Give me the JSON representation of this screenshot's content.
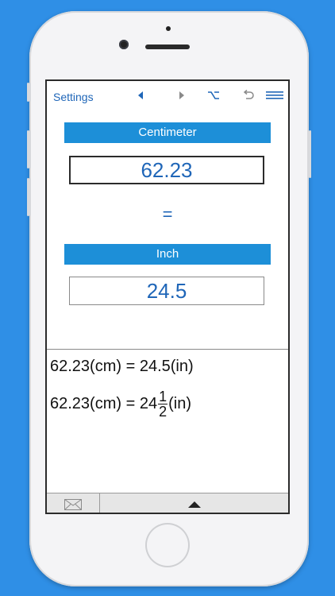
{
  "toolbar": {
    "settings_label": "Settings",
    "icons": [
      "back-arrow-icon",
      "forward-arrow-icon",
      "option-key-icon",
      "undo-icon",
      "menu-icon"
    ]
  },
  "converter": {
    "from_unit": "Centimeter",
    "from_value": "62.23",
    "equals": "=",
    "to_unit": "Inch",
    "to_value": "24.5"
  },
  "results": {
    "line1": "62.23(cm) = 24.5(in)",
    "line2_prefix": "62.23(cm) = 24",
    "line2_numerator": "1",
    "line2_denominator": "2",
    "line2_suffix": "(in)"
  },
  "colors": {
    "background": "#2f8fe6",
    "accent": "#1d8fd8",
    "link": "#1f66b8"
  }
}
